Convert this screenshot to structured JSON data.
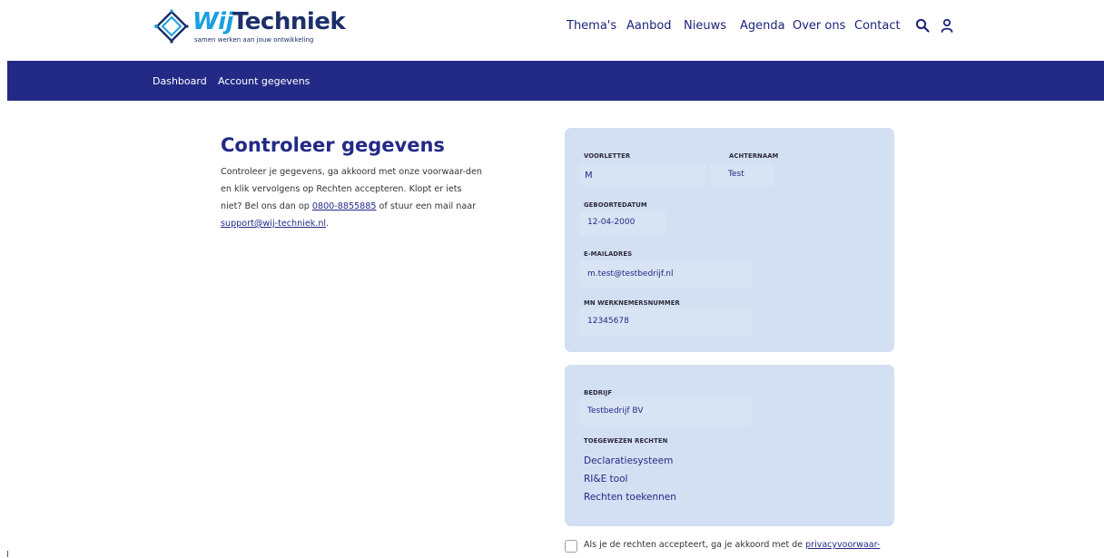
{
  "brand": {
    "name_part1": "Wij",
    "name_part2": "Techniek",
    "tagline": "samen werken aan jouw ontwikkeling",
    "colors": {
      "primary": "#232a86",
      "accent": "#1aa0e0",
      "card": "#d3dff2"
    }
  },
  "nav": {
    "items": [
      "Thema's",
      "Aanbod",
      "Nieuws",
      "Agenda",
      "Over ons",
      "Contact"
    ],
    "icons": [
      "search-icon",
      "user-icon"
    ]
  },
  "subnav": {
    "items": [
      "Dashboard",
      "Account gegevens"
    ]
  },
  "main": {
    "title": "Controleer gegevens",
    "intro_part1": "Controleer je gegevens, ga akkoord met onze voorwaar-den en klik vervolgens op Rechten accepteren. Klopt er iets niet? Bel ons dan op ",
    "phone": "0800-8855885",
    "intro_part2": " of stuur een mail naar ",
    "email": "support@wij-techniek.nl",
    "intro_part3": "."
  },
  "personal": {
    "initials_label": "VOORLETTER",
    "initials_value": "M",
    "lastname_label": "ACHTERNAAM",
    "lastname_value": "Test",
    "dob_label": "GEBOORTEDATUM",
    "dob_value": "12-04-2000",
    "email_label": "E-MAILADRES",
    "email_value": "m.test@testbedrijf.nl",
    "employee_label": "MN WERKNEMERSNUMMER",
    "employee_value": "12345678"
  },
  "company": {
    "company_label": "BEDRIJF",
    "company_value": "Testbedrijf BV",
    "rights_label": "TOEGEWEZEN RECHTEN",
    "rights": [
      "Declaratiesysteem",
      "RI&E tool",
      "Rechten toekennen"
    ]
  },
  "consent": {
    "text": "Als je de rechten accepteert, ga je akkoord met de ",
    "link": "privacyvoorwaar-"
  }
}
